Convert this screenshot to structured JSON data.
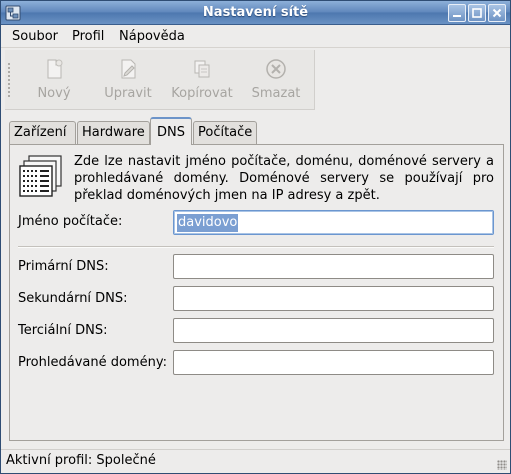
{
  "window": {
    "title": "Nastavení sítě",
    "app_icon": "network-config-icon",
    "controls": [
      "minimize-icon",
      "maximize-icon",
      "close-icon"
    ]
  },
  "menubar": {
    "items": [
      {
        "label": "Soubor"
      },
      {
        "label": "Profil"
      },
      {
        "label": "Nápověda"
      }
    ]
  },
  "toolbar": {
    "buttons": [
      {
        "label": "Nový",
        "icon": "new-document-icon",
        "enabled": false
      },
      {
        "label": "Upravit",
        "icon": "edit-icon",
        "enabled": false
      },
      {
        "label": "Kopírovat",
        "icon": "copy-icon",
        "enabled": false
      },
      {
        "label": "Smazat",
        "icon": "delete-icon",
        "enabled": false
      }
    ]
  },
  "tabs": {
    "items": [
      {
        "label": "Zařízení"
      },
      {
        "label": "Hardware"
      },
      {
        "label": "DNS"
      },
      {
        "label": "Počítače"
      }
    ],
    "active": "DNS"
  },
  "dns_panel": {
    "info_icon": "dns-table-icon",
    "info_text": "Zde lze nastavit jméno počítače, doménu, doménové servery a prohledávané domény. Doménové servery se používají pro překlad doménových jmen na IP adresy a zpět.",
    "hostname": {
      "label": "Jméno počítače:",
      "value": "davidovo"
    },
    "primary_dns": {
      "label": "Primární DNS:",
      "value": ""
    },
    "secondary_dns": {
      "label": "Sekundární DNS:",
      "value": ""
    },
    "tertiary_dns": {
      "label": "Terciální DNS:",
      "value": ""
    },
    "search_domains": {
      "label": "Prohledávané domény:",
      "value": ""
    }
  },
  "statusbar": {
    "text": "Aktivní profil: Společné"
  },
  "colors": {
    "titlebar": "#5f86bb",
    "selection": "#7b9fd2",
    "active_tab_accent": "#6d94c9",
    "window_bg": "#edeceb"
  }
}
